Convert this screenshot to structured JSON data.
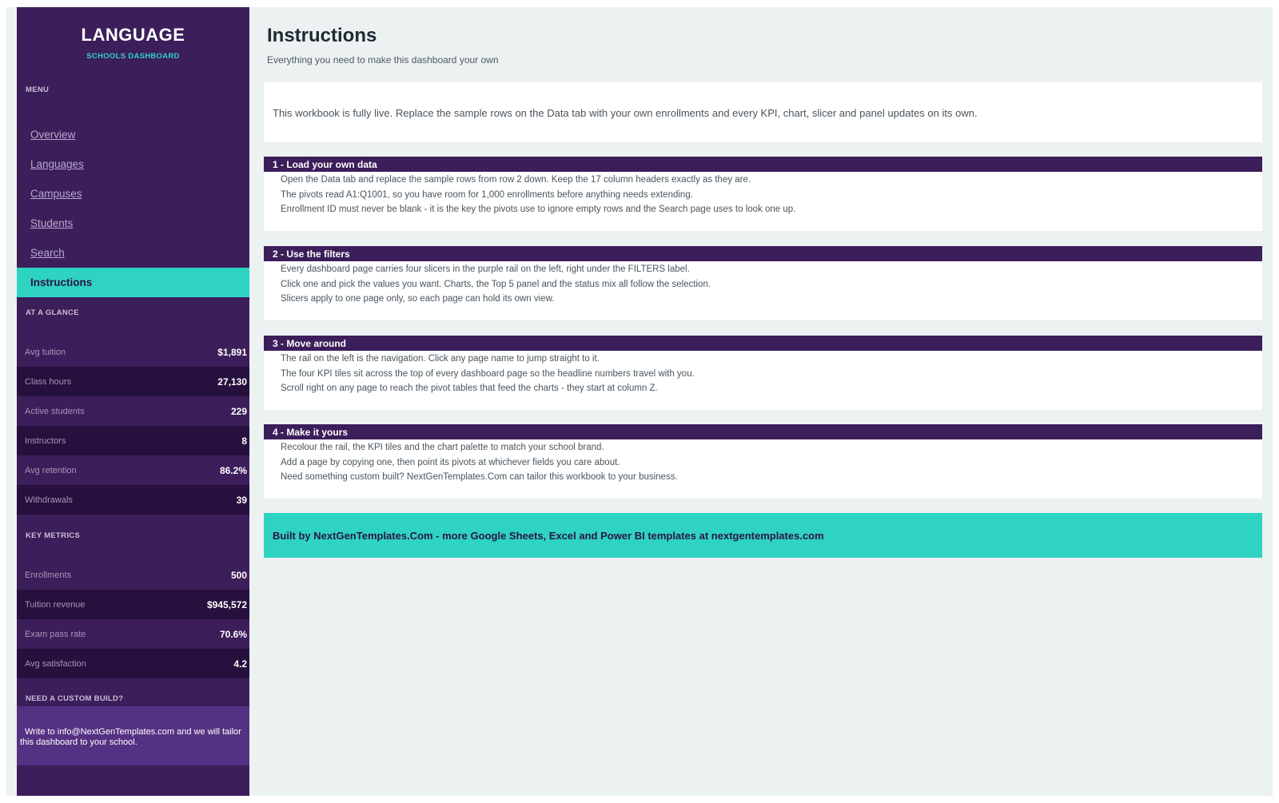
{
  "brand": {
    "title": "LANGUAGE",
    "subtitle": "SCHOOLS DASHBOARD"
  },
  "menu": {
    "label": "MENU",
    "items": [
      "Overview",
      "Languages",
      "Campuses",
      "Students",
      "Search",
      "Instructions"
    ],
    "active": "Instructions"
  },
  "at_a_glance": {
    "label": "AT A GLANCE",
    "rows": [
      {
        "label": "Avg tuition",
        "value": "$1,891"
      },
      {
        "label": "Class hours",
        "value": "27,130"
      },
      {
        "label": "Active students",
        "value": "229"
      },
      {
        "label": "Instructors",
        "value": "8"
      },
      {
        "label": "Avg retention",
        "value": "86.2%"
      },
      {
        "label": "Withdrawals",
        "value": "39"
      }
    ]
  },
  "key_metrics": {
    "label": "KEY METRICS",
    "rows": [
      {
        "label": "Enrollments",
        "value": "500"
      },
      {
        "label": "Tuition revenue",
        "value": "$945,572"
      },
      {
        "label": "Exam pass rate",
        "value": "70.6%"
      },
      {
        "label": "Avg satisfaction",
        "value": "4.2"
      }
    ]
  },
  "custom_build": {
    "label": "NEED A CUSTOM BUILD?",
    "line1": "Write to info@NextGenTemplates.com and we will tailor",
    "line2": "this dashboard to your school."
  },
  "main": {
    "title": "Instructions",
    "subtitle": "Everything you need to make this dashboard your own",
    "intro": "This workbook is fully live. Replace the sample rows on the Data tab with your own enrollments and every KPI, chart, slicer and panel updates on its own.",
    "steps": [
      {
        "heading": "1  -  Load your own data",
        "lines": [
          "Open the Data tab and replace the sample rows from row 2 down. Keep the 17 column headers exactly as they are.",
          "The pivots read A1:Q1001, so you have room for 1,000 enrollments before anything needs extending.",
          "Enrollment ID must never be blank - it is the key the pivots use to ignore empty rows and the Search page uses to look one up."
        ]
      },
      {
        "heading": "2  -  Use the filters",
        "lines": [
          "Every dashboard page carries four slicers in the purple rail on the left, right under the FILTERS label.",
          "Click one and pick the values you want. Charts, the Top 5 panel and the status mix all follow the selection.",
          "Slicers apply to one page only, so each page can hold its own view."
        ]
      },
      {
        "heading": "3  -  Move around",
        "lines": [
          "The rail on the left is the navigation. Click any page name to jump straight to it.",
          "The four KPI tiles sit across the top of every dashboard page so the headline numbers travel with you.",
          "Scroll right on any page to reach the pivot tables that feed the charts - they start at column Z."
        ]
      },
      {
        "heading": "4  -  Make it yours",
        "lines": [
          "Recolour the rail, the KPI tiles and the chart palette to match your school brand.",
          "Add a page by copying one, then point its pivots at whichever fields you care about.",
          "Need something custom built? NextGenTemplates.Com can tailor this workbook to your business."
        ]
      }
    ],
    "footer": "Built by NextGenTemplates.Com  -  more Google Sheets, Excel and Power BI templates at nextgentemplates.com"
  }
}
